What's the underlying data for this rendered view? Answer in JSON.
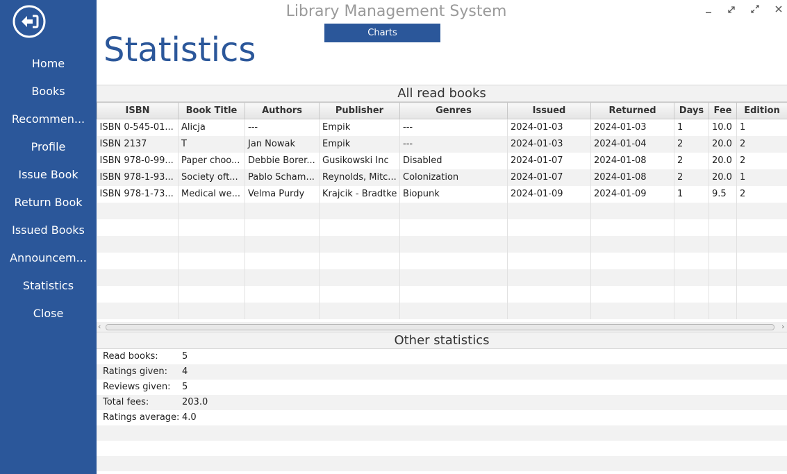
{
  "window": {
    "title": "Library Management System",
    "controls": [
      "minimize-icon",
      "restore-icon",
      "maximize-icon",
      "close-icon"
    ]
  },
  "sidebar": {
    "back_icon": "back-arrow-icon",
    "items": [
      {
        "label": "Home"
      },
      {
        "label": "Books"
      },
      {
        "label": "Recommen..."
      },
      {
        "label": "Profile"
      },
      {
        "label": "Issue Book"
      },
      {
        "label": "Return Book"
      },
      {
        "label": "Issued Books"
      },
      {
        "label": "Announcem..."
      },
      {
        "label": "Statistics"
      },
      {
        "label": "Close"
      }
    ]
  },
  "header": {
    "charts_button": "Charts",
    "page_title": "Statistics"
  },
  "read_books": {
    "title": "All read books",
    "columns": [
      "ISBN",
      "Book Title",
      "Authors",
      "Publisher",
      "Genres",
      "Issued",
      "Returned",
      "Days",
      "Fee",
      "Edition"
    ],
    "rows": [
      [
        "ISBN 0-545-01...",
        "Alicja",
        "---",
        "Empik",
        "---",
        "2024-01-03",
        "2024-01-03",
        "1",
        "10.0",
        "1"
      ],
      [
        "ISBN 2137",
        "T",
        "Jan Nowak",
        "Empik",
        "---",
        "2024-01-03",
        "2024-01-04",
        "2",
        "20.0",
        "2"
      ],
      [
        "ISBN 978-0-99...",
        "Paper choo...",
        "Debbie Borer...",
        "Gusikowski Inc",
        "Disabled",
        "2024-01-07",
        "2024-01-08",
        "2",
        "20.0",
        "2"
      ],
      [
        "ISBN 978-1-93...",
        "Society oft...",
        "Pablo Scham...",
        "Reynolds, Mitc...",
        "Colonization",
        "2024-01-07",
        "2024-01-08",
        "2",
        "20.0",
        "1"
      ],
      [
        "ISBN 978-1-73...",
        "Medical we...",
        "Velma Purdy",
        "Krajcik - Bradtke",
        "Biopunk",
        "2024-01-09",
        "2024-01-09",
        "1",
        "9.5",
        "2"
      ]
    ],
    "empty_rows": 7
  },
  "other_stats": {
    "title": "Other statistics",
    "items": [
      {
        "label": "Read books:",
        "value": "5"
      },
      {
        "label": "Ratings given:",
        "value": "4"
      },
      {
        "label": "Reviews given:",
        "value": "5"
      },
      {
        "label": "Total fees:",
        "value": "203.0"
      },
      {
        "label": "Ratings average:",
        "value": "4.0"
      }
    ],
    "empty_rows": 3
  },
  "colors": {
    "accent": "#2b579a",
    "title_gray": "#9a9a9a",
    "stripe": "#f2f2f2"
  }
}
